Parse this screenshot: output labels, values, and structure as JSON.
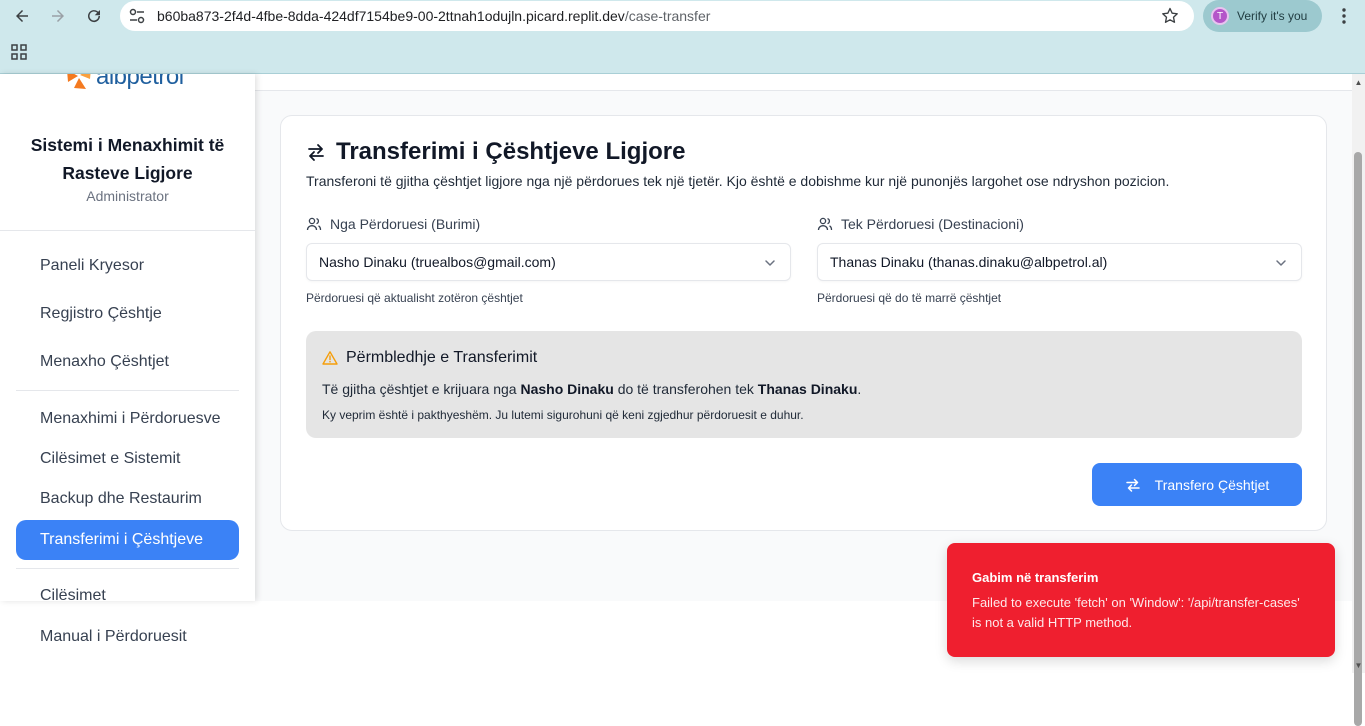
{
  "browser": {
    "url_host": "b60ba873-2f4d-4fbe-8dda-424df7154be9-00-2ttnah1odujln.picard.replit.dev",
    "url_path": "/case-transfer",
    "verify_label": "Verify it's you",
    "avatar_letter": "T"
  },
  "sidebar": {
    "logo_text": "albpetrol",
    "title": "Sistemi i Menaxhimit të Rasteve Ligjore",
    "role": "Administrator",
    "items": [
      {
        "label": "Paneli Kryesor"
      },
      {
        "label": "Regjistro Çështje"
      },
      {
        "label": "Menaxho Çështjet"
      },
      {
        "label": "Menaxhimi i Përdoruesve"
      },
      {
        "label": "Cilësimet e Sistemit"
      },
      {
        "label": "Backup dhe Restaurim"
      },
      {
        "label": "Transferimi i Çështjeve"
      },
      {
        "label": "Cilësimet"
      },
      {
        "label": "Manual i Përdoruesit"
      }
    ]
  },
  "main": {
    "title": "Transferimi i Çështjeve Ligjore",
    "description": "Transferoni të gjitha çështjet ligjore nga një përdorues tek një tjetër. Kjo është e dobishme kur një punonjës largohet ose ndryshon pozicion.",
    "from": {
      "label": "Nga Përdoruesi (Burimi)",
      "value": "Nasho Dinaku (truealbos@gmail.com)",
      "helper": "Përdoruesi që aktualisht zotëron çështjet"
    },
    "to": {
      "label": "Tek Përdoruesi (Destinacioni)",
      "value": "Thanas Dinaku (thanas.dinaku@albpetrol.al)",
      "helper": "Përdoruesi që do të marrë çështjet"
    },
    "summary": {
      "title": "Përmbledhje e Transferimit",
      "line_prefix": "Të gjitha çështjet e krijuara nga",
      "from_name": "Nasho Dinaku",
      "line_middle": "do të transferohen tek",
      "to_name": "Thanas Dinaku",
      "line_suffix": ".",
      "note": "Ky veprim është i pakthyeshëm. Ju lutemi sigurohuni që keni zgjedhur përdoruesit e duhur."
    },
    "transfer_button": "Transfero Çështjet"
  },
  "toast": {
    "title": "Gabim në transferim",
    "message": "Failed to execute 'fetch' on 'Window': '/api/transfer-cases' is not a valid HTTP method."
  },
  "colors": {
    "accent": "#3b82f6",
    "error": "#ef1f2f",
    "chrome": "#cfe8ec",
    "warning": "#f59e0b"
  }
}
